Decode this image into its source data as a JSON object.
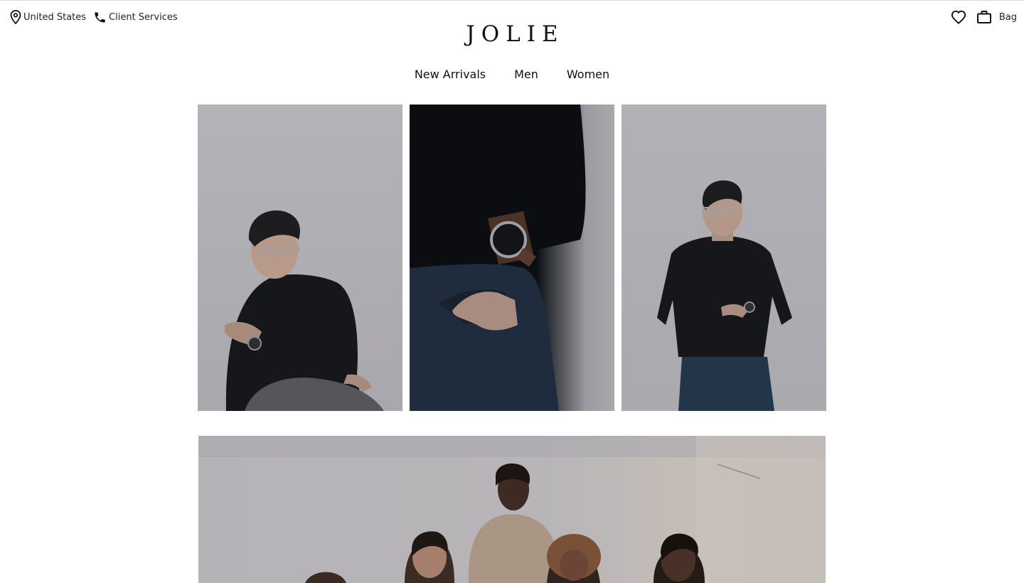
{
  "utility": {
    "location_label": "United States",
    "client_services_label": "Client Services",
    "bag_label": "Bag"
  },
  "brand": {
    "logo_text": "JOLIE"
  },
  "nav": {
    "items": [
      {
        "label": "New Arrivals"
      },
      {
        "label": "Men"
      },
      {
        "label": "Women"
      }
    ]
  },
  "icons": {
    "location": "map-pin-icon",
    "phone": "phone-icon",
    "wishlist": "heart-icon",
    "bag": "shopping-bag-icon"
  },
  "colors": {
    "background": "#ffffff",
    "text": "#111111"
  }
}
